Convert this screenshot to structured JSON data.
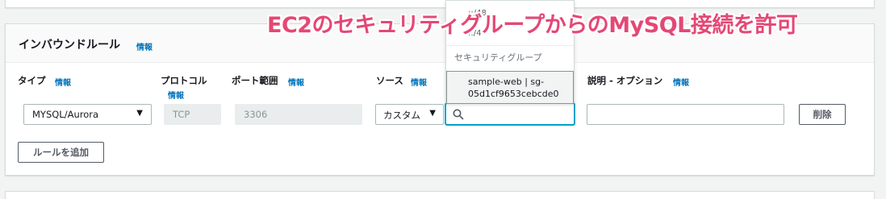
{
  "annotation": {
    "text": "EC2のセキュリティグループからのMySQL接続を許可"
  },
  "section": {
    "title": "インバウンドルール",
    "info": "情報"
  },
  "columns": {
    "type": {
      "label": "タイプ",
      "info": "情報"
    },
    "protocol": {
      "label": "プロトコル",
      "info": "情報"
    },
    "port": {
      "label": "ポート範囲",
      "info": "情報"
    },
    "source": {
      "label": "ソース",
      "info": "情報"
    },
    "description": {
      "label": "説明 - オプション",
      "info": "情報"
    }
  },
  "rule": {
    "type_value": "MYSQL/Aurora",
    "protocol_value": "TCP",
    "port_value": "3306",
    "source_mode": "カスタム",
    "source_search": "",
    "description_value": ""
  },
  "dropdown": {
    "partial_1": "::/48",
    "partial_2": "::/4",
    "group_label": "セキュリティグループ",
    "option_line1": "sample-web | sg-",
    "option_line2": "05d1cf9653cebcde0"
  },
  "buttons": {
    "delete": "削除",
    "add_rule": "ルールを追加"
  },
  "colors": {
    "accent": "#0073bb",
    "annotation": "#e44875",
    "focus": "#00a1c9"
  }
}
